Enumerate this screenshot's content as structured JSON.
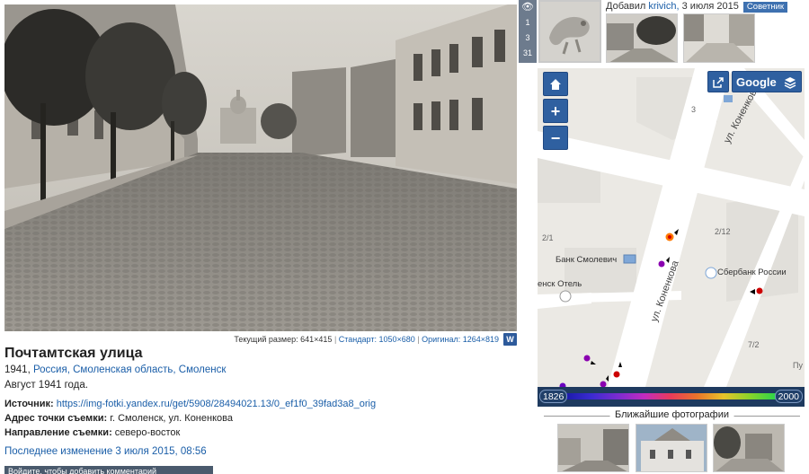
{
  "photo": {
    "size_label": "Текущий размер: 641×415",
    "standard_link": "Стандарт: 1050×680",
    "original_link": "Оригинал: 1264×819",
    "w_button": "W"
  },
  "info": {
    "title": "Почтамтская улица",
    "year": "1941,",
    "country": "Россия,",
    "region": "Смоленская область,",
    "city": "Смоленск",
    "date_text": "Август 1941 года.",
    "source_label": "Источник:",
    "source_url": "https://img-fotki.yandex.ru/get/5908/28494021.13/0_ef1f0_39fad3a8_orig",
    "address_label": "Адрес точки съемки:",
    "address_value": "г. Смоленск, ул. Коненкова",
    "direction_label": "Направление съемки:",
    "direction_value": "северо-восток",
    "last_modified": "Последнее изменение 3 июля 2015, 08:56",
    "bottom_bar": "Войдите, чтобы добавить комментарий"
  },
  "stats": {
    "eye_icon": "eye-icon",
    "views_1": "1",
    "views_2": "3",
    "views_3": "31"
  },
  "uploader": {
    "prefix": "Добавил",
    "user": "krivich,",
    "date": "3 июля 2015",
    "badge": "Советник"
  },
  "map": {
    "home_icon": "home-icon",
    "zoom_in": "+",
    "zoom_out": "−",
    "share_icon": "share-icon",
    "layer_label": "Google",
    "street_labels": [
      "ул. Коненкова",
      "ул. Коненкова"
    ],
    "poi_labels": [
      "Банк Смолевич",
      "Сбербанк России",
      "енск Отель"
    ],
    "house_numbers": [
      "3",
      "2/1",
      "2/12",
      "7/2",
      "Пу"
    ]
  },
  "timeline": {
    "start_year": "1826",
    "end_year": "2000"
  },
  "nearby": {
    "title": "Ближайшие фотографии"
  },
  "colors": {
    "accent": "#2f60a0",
    "link": "#1a5ea8",
    "badge": "#3e71b0"
  }
}
